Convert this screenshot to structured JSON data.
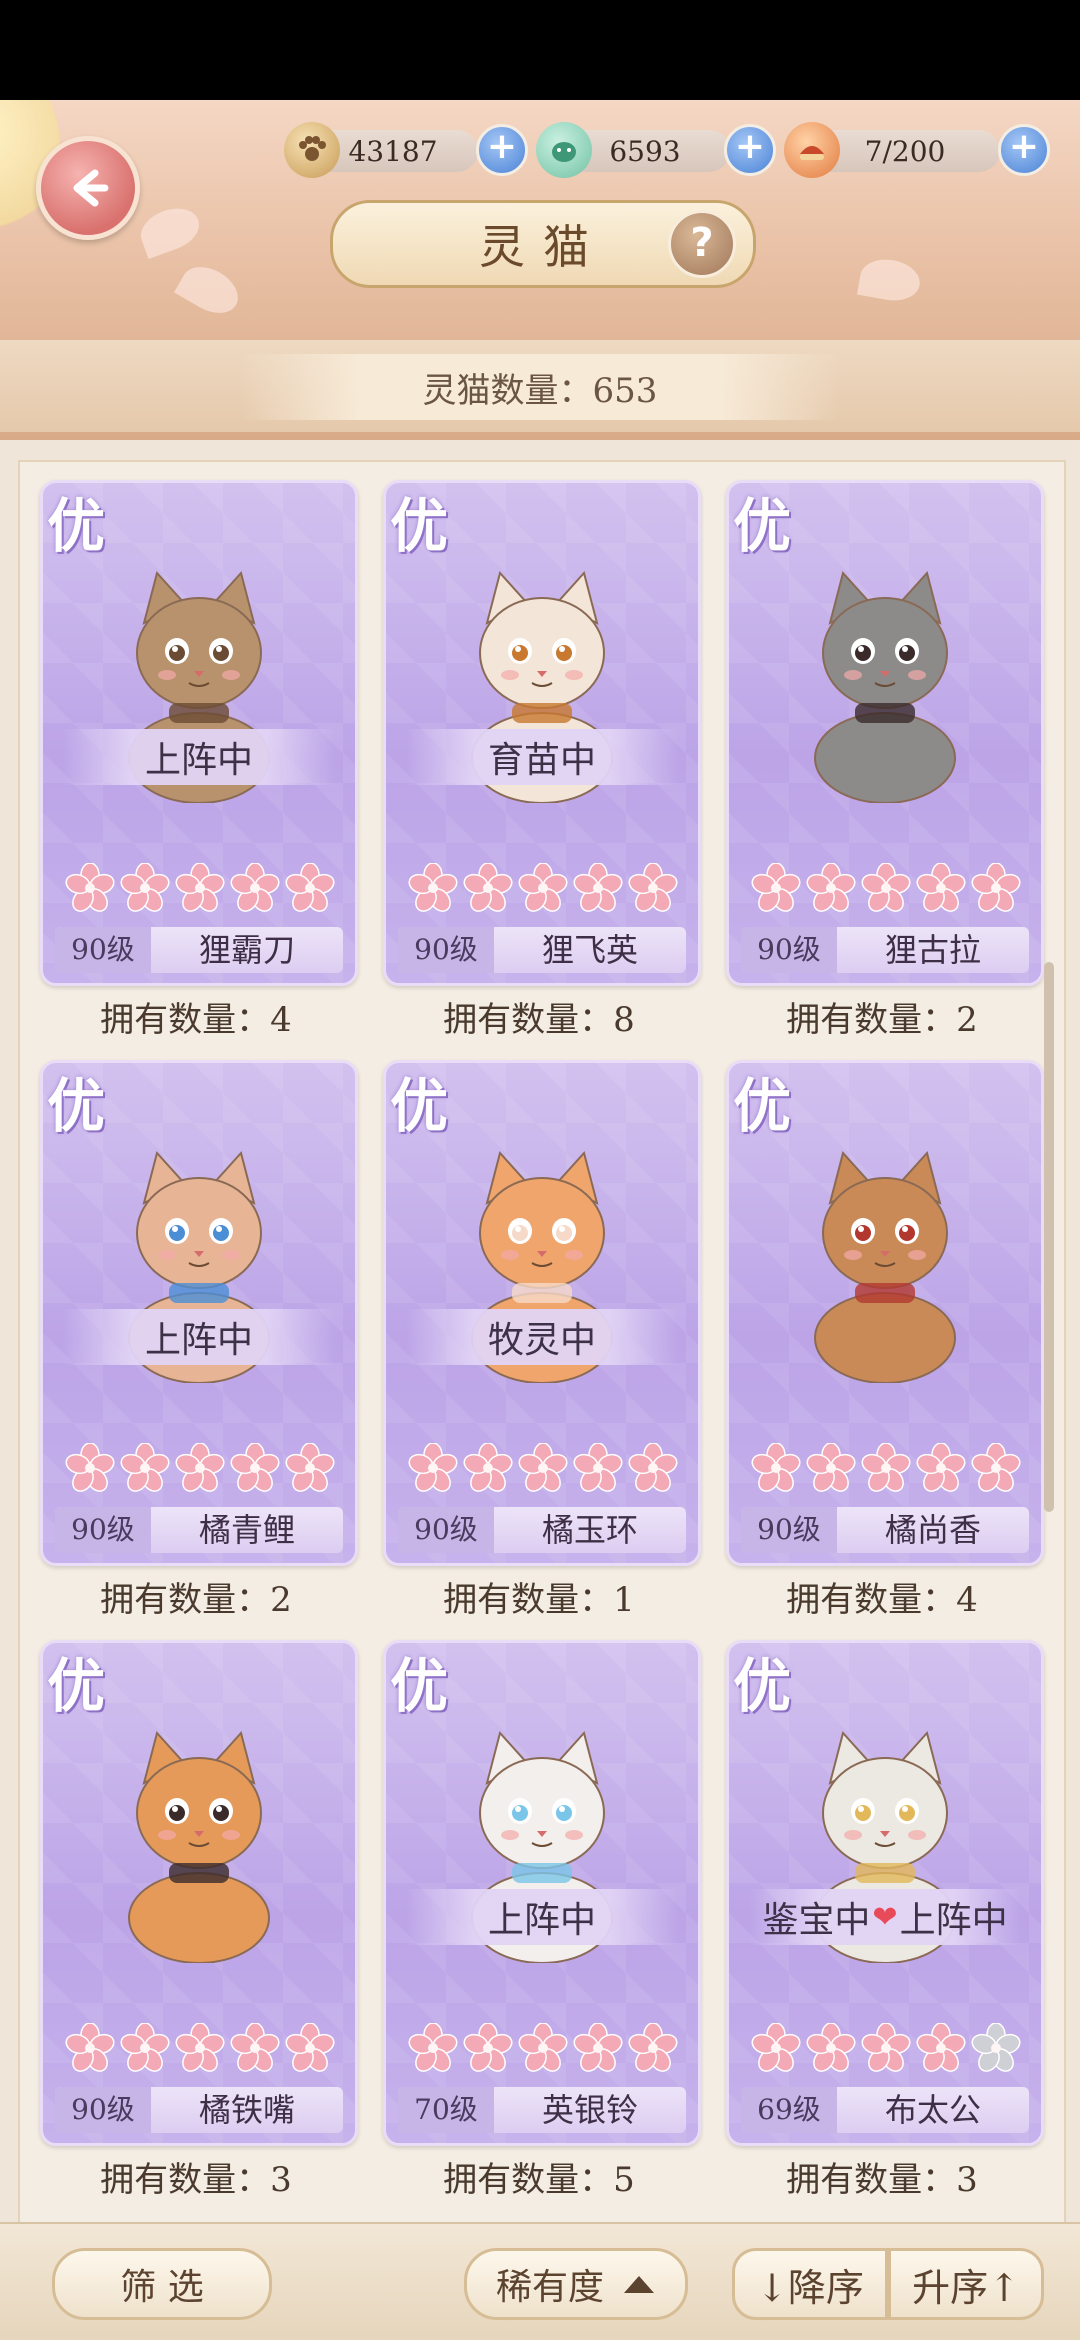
{
  "header": {
    "title": "灵猫",
    "resources": [
      {
        "icon": "paw-coin-icon",
        "value": "43187"
      },
      {
        "icon": "jade-pet-icon",
        "value": "6593"
      },
      {
        "icon": "fish-food-icon",
        "value": "7/200"
      }
    ],
    "cat_count_text": "灵猫数量：653"
  },
  "cards": [
    {
      "grade": "优",
      "status": "上阵中",
      "level": "90级",
      "name": "狸霸刀",
      "owned": "拥有数量：4",
      "stars": 5,
      "coat": "#b7926c",
      "accent": "#6b4b33"
    },
    {
      "grade": "优",
      "status": "育苗中",
      "level": "90级",
      "name": "狸飞英",
      "owned": "拥有数量：8",
      "stars": 5,
      "coat": "#f3e6d8",
      "accent": "#c8782f"
    },
    {
      "grade": "优",
      "status": "",
      "level": "90级",
      "name": "狸古拉",
      "owned": "拥有数量：2",
      "stars": 5,
      "coat": "#8d8a8a",
      "accent": "#3a2a2a"
    },
    {
      "grade": "优",
      "status": "上阵中",
      "level": "90级",
      "name": "橘青鲤",
      "owned": "拥有数量：2",
      "stars": 5,
      "coat": "#e7b596",
      "accent": "#4c8ed6"
    },
    {
      "grade": "优",
      "status": "牧灵中",
      "level": "90级",
      "name": "橘玉环",
      "owned": "拥有数量：1",
      "stars": 5,
      "coat": "#f0a56c",
      "accent": "#f6d9c9"
    },
    {
      "grade": "优",
      "status": "",
      "level": "90级",
      "name": "橘尚香",
      "owned": "拥有数量：4",
      "stars": 5,
      "coat": "#c98a58",
      "accent": "#b2382f"
    },
    {
      "grade": "优",
      "status": "",
      "level": "90级",
      "name": "橘铁嘴",
      "owned": "拥有数量：3",
      "stars": 5,
      "coat": "#e59a5a",
      "accent": "#3a2a2a"
    },
    {
      "grade": "优",
      "status": "上阵中",
      "level": "70级",
      "name": "英银铃",
      "owned": "拥有数量：5",
      "stars": 5,
      "coat": "#f3efec",
      "accent": "#7bc6e8"
    },
    {
      "grade": "优",
      "status_left": "鉴宝中",
      "status_right": "上阵中",
      "level": "69级",
      "name": "布太公",
      "owned": "拥有数量：3",
      "stars": 4,
      "coat": "#ece8e2",
      "accent": "#e2b85a"
    }
  ],
  "bottom": {
    "filter_label": "筛 选",
    "rarity_label": "稀有度",
    "desc_label": "↓降序",
    "asc_label": "升序↑"
  },
  "colors": {
    "card_purple": "#bca4e7",
    "flower_pink": "#f4a9b7",
    "flower_gray": "#cfcfd6",
    "plus_blue": "#4b83d6"
  }
}
